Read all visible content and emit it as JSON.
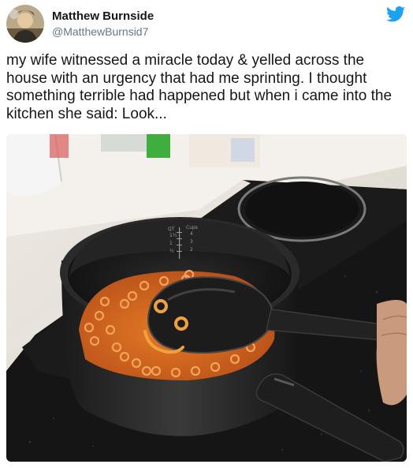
{
  "user": {
    "display_name": "Matthew Burnside",
    "handle": "@MatthewBurnsid7",
    "avatar_icon": "avatar-photo"
  },
  "platform_icon": "twitter-bird-icon",
  "brand_color": "#1da1f2",
  "tweet": {
    "text": "my wife witnessed a miracle today & yelled across the house with an urgency that had me sprinting. I thought something terrible had happened but when i came into the kitchen she said: Look..."
  },
  "photo": {
    "measuring_labels": [
      "QT",
      "Cups",
      "1½",
      "4",
      "1",
      "3",
      "2",
      "½",
      "1",
      "1/2"
    ]
  }
}
